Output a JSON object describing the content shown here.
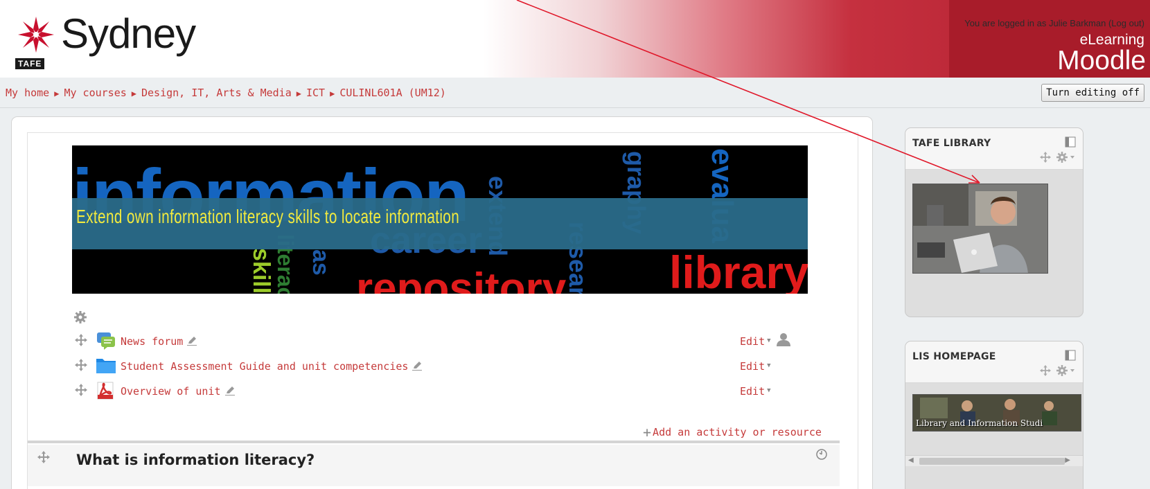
{
  "header": {
    "logo_text": "Sydney",
    "logo_badge": "TAFE",
    "login_prefix": "You are logged in as",
    "user_name": "Julie Barkman",
    "logout_label": "(Log out)",
    "brand_line1": "eLearning",
    "brand_line2": "Moodle"
  },
  "breadcrumb": {
    "separator": "▶",
    "items": [
      "My home",
      "My courses",
      "Design, IT, Arts & Media",
      "ICT",
      "CULINL601A (UM12)"
    ]
  },
  "edit_toggle_label": "Turn editing off",
  "banner": {
    "caption": "Extend own information literacy skills to locate information",
    "words": [
      "information",
      "career",
      "library",
      "repository",
      "extend",
      "graphy",
      "evalua",
      "skills",
      "literacy",
      "research",
      "as"
    ]
  },
  "activities": [
    {
      "name": "News forum",
      "edit_label": "Edit",
      "icon": "forum-icon",
      "has_role_icon": true
    },
    {
      "name": "Student Assessment Guide and unit competencies",
      "edit_label": "Edit",
      "icon": "folder-icon",
      "has_role_icon": false
    },
    {
      "name": "Overview of unit",
      "edit_label": "Edit",
      "icon": "pdf-icon",
      "has_role_icon": false
    }
  ],
  "add_activity_label": "Add an activity or resource",
  "next_section_title": "What is information literacy?",
  "blocks": [
    {
      "title": "TAFE LIBRARY"
    },
    {
      "title": "LIS HOMEPAGE",
      "image_caption": "Library and Information Studi"
    }
  ],
  "colors": {
    "link": "#c53a3a",
    "brand_red": "#a81c2a",
    "banner_caption": "#f2ea3e",
    "annotation_arrow": "#e0182a"
  }
}
